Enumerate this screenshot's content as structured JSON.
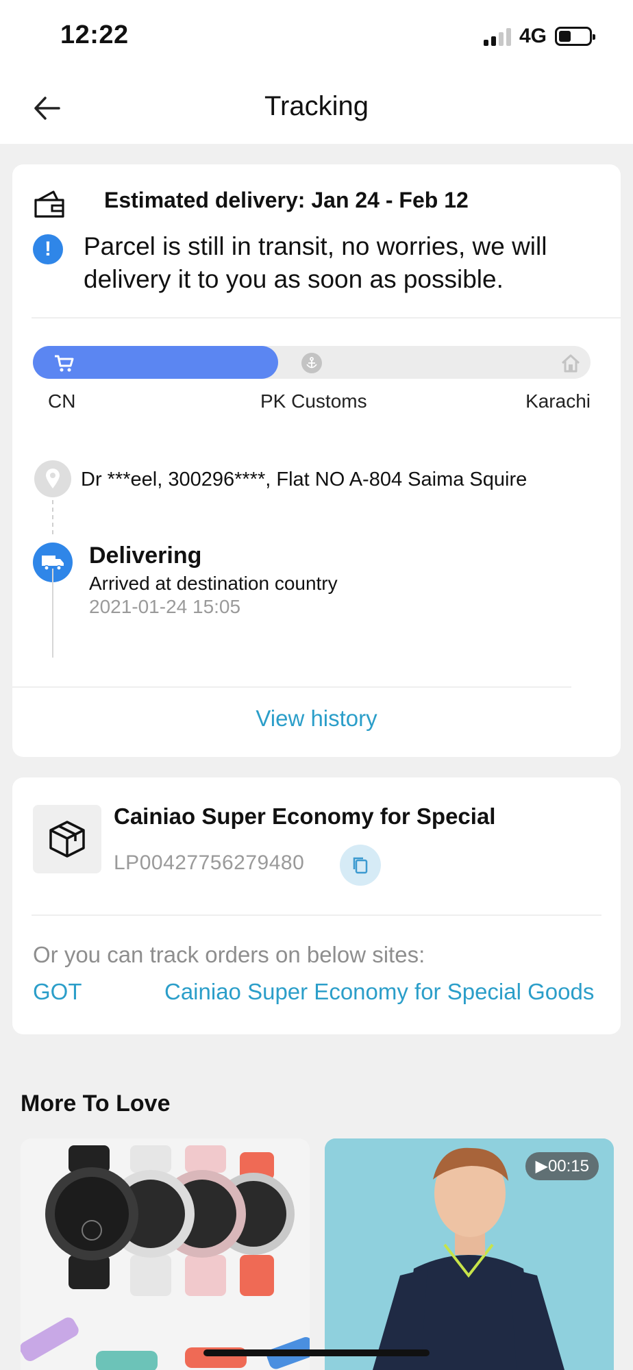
{
  "status_bar": {
    "time": "12:22",
    "network": "4G"
  },
  "header": {
    "title": "Tracking"
  },
  "tracking": {
    "estimated_delivery": "Estimated delivery: Jan 24 - Feb 12",
    "notice": "Parcel is still in transit, no worries, we will delivery it to you as soon as possible.",
    "progress_fraction": 0.44,
    "steps": [
      "CN",
      "PK Customs",
      "Karachi"
    ],
    "address": "Dr ***eel,  300296****,  Flat NO A-804 Saima Squire",
    "latest_event": {
      "status": "Delivering",
      "description": "Arrived at destination country",
      "time": "2021-01-24 15:05"
    },
    "view_history": "View history"
  },
  "shipment": {
    "carrier": "Cainiao Super Economy for Special",
    "tracking_number": "LP00427756279480",
    "other_sites_label": "Or you can track orders on below sites:",
    "sites": [
      "GOT",
      "Cainiao Super Economy for Special Goods"
    ]
  },
  "recommendations": {
    "title": "More To Love",
    "products": [
      {
        "badge": ""
      },
      {
        "badge": "▶00:15"
      }
    ]
  },
  "colors": {
    "accent_blue": "#5b86f2",
    "link": "#2b9ec9",
    "info": "#2f86e8"
  }
}
